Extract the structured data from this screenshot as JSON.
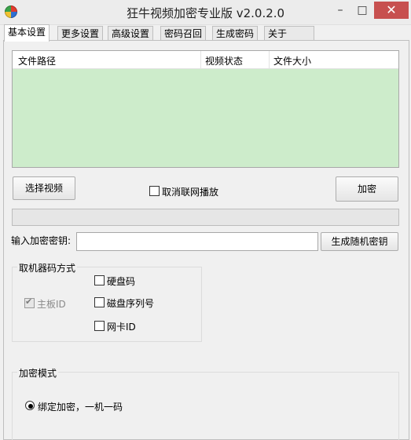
{
  "window": {
    "title": "狂牛视频加密专业版 v2.0.2.0",
    "minimize": "–",
    "maximize": "□",
    "close": "✕"
  },
  "tabs": [
    "基本设置",
    "更多设置",
    "高级设置",
    "密码召回",
    "生成密码",
    "关于"
  ],
  "file_table": {
    "columns": [
      "文件路径",
      "视频状态",
      "文件大小"
    ],
    "rows": []
  },
  "select_video_button": "选择视频",
  "cancel_network_play": {
    "label": "取消联网播放",
    "checked": false
  },
  "encrypt_button": "加密",
  "progress": {
    "value": 0
  },
  "key_label": "输入加密密钥:",
  "key_input": {
    "value": "",
    "placeholder": ""
  },
  "generate_key_button": "生成随机密钥",
  "machine_code": {
    "legend": "取机器码方式",
    "mainboard": {
      "label": "主板ID",
      "checked": true,
      "disabled": true
    },
    "disk_code": {
      "label": "硬盘码",
      "checked": false
    },
    "disk_serial": {
      "label": "磁盘序列号",
      "checked": false
    },
    "nic_id": {
      "label": "网卡ID",
      "checked": false
    }
  },
  "encrypt_mode": {
    "legend": "加密模式",
    "option1": {
      "label": "绑定加密，一机一码",
      "selected": true
    }
  },
  "colors": {
    "table_bg": "#cdeccb",
    "close_btn": "#c7504f"
  },
  "icons": {
    "app": "app-logo-icon",
    "check": "checkmark-icon"
  }
}
